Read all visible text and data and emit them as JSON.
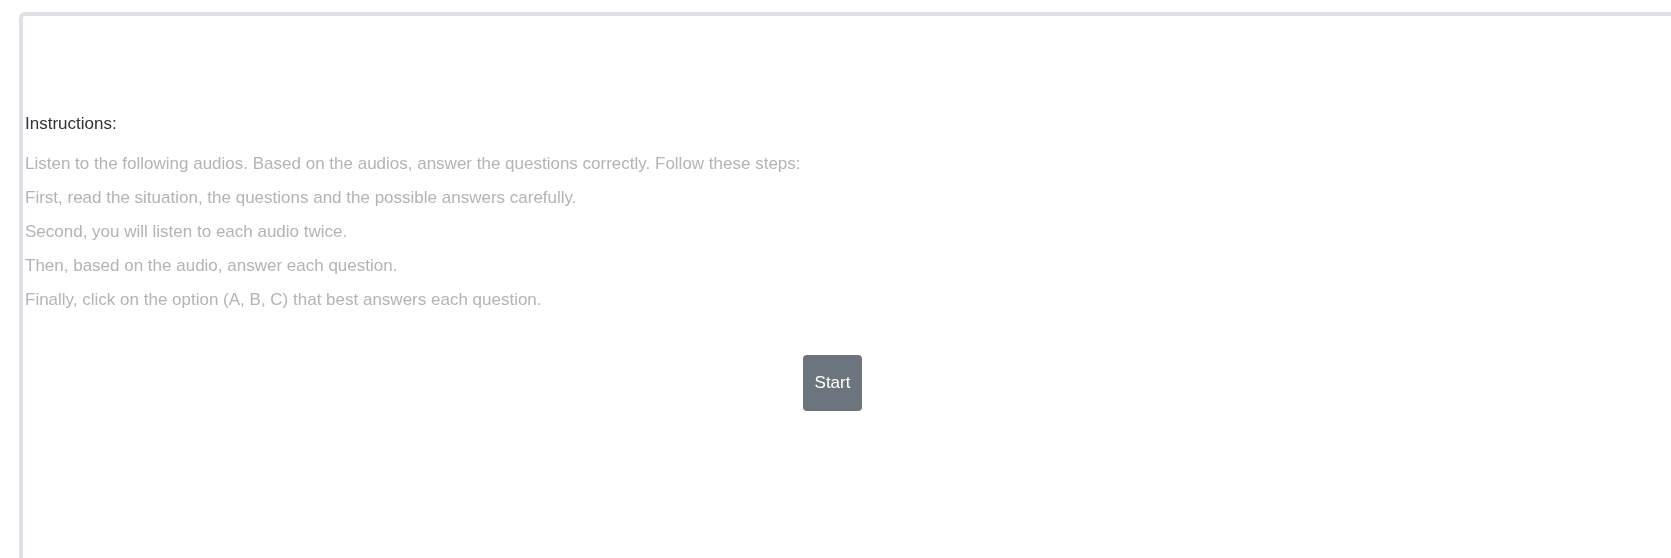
{
  "instructions": {
    "heading": "Instructions:",
    "lines": [
      "Listen to the following audios. Based on the audios, answer the questions correctly. Follow these steps:",
      "First, read the situation, the questions and the possible answers carefully.",
      "Second, you will listen to each audio twice.",
      "Then, based on the audio, answer each question.",
      "Finally, click on the option (A, B, C) that best answers each question."
    ]
  },
  "start_button": "Start"
}
